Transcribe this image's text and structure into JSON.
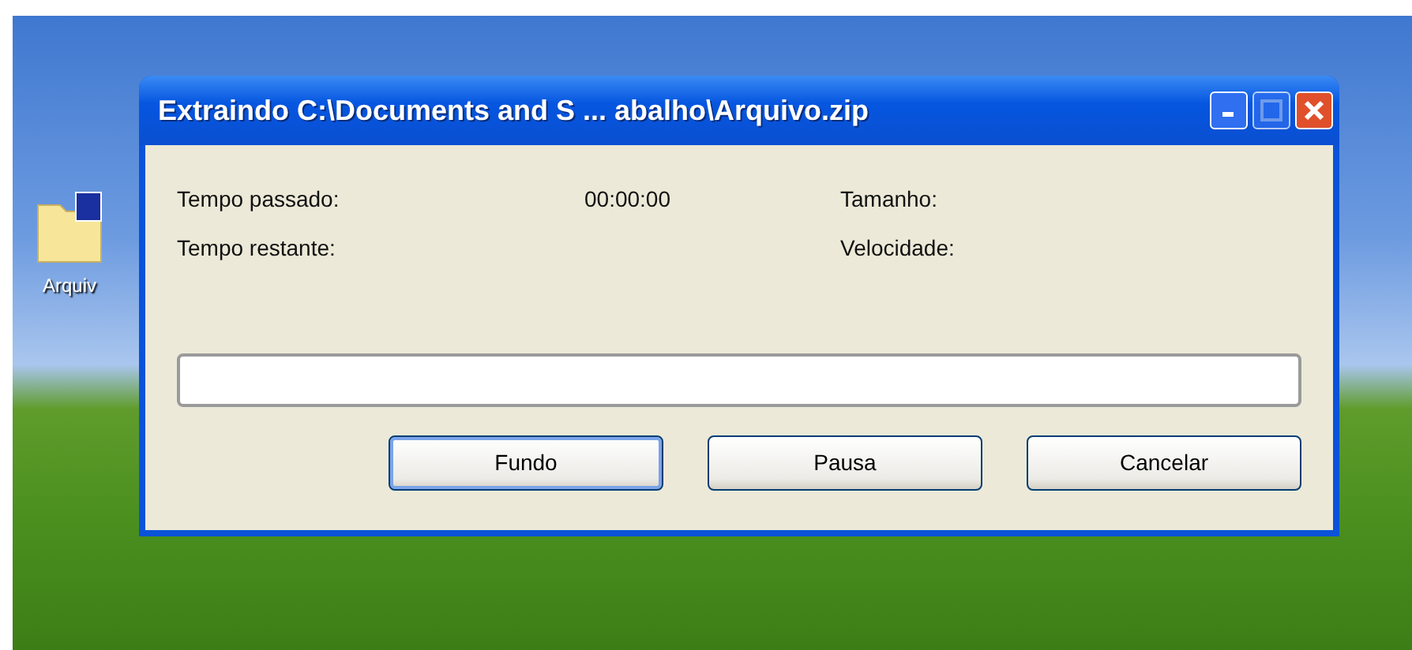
{
  "desktop": {
    "icons": [
      {
        "label": "Arquiv"
      }
    ]
  },
  "window": {
    "title": "Extraindo C:\\Documents and S ... abalho\\Arquivo.zip"
  },
  "stats": [
    {
      "label": "Tempo passado:",
      "value": "00:00:00"
    },
    {
      "label": "Tamanho:"
    },
    {
      "label": "Tempo restante:"
    },
    {
      "label": "Velocidade:"
    }
  ],
  "progress": {
    "level": 0
  },
  "buttons": [
    {
      "label": "Fundo",
      "default": true
    },
    {
      "label": "Pausa",
      "default": false
    },
    {
      "label": "Cancelar",
      "default": false
    }
  ]
}
